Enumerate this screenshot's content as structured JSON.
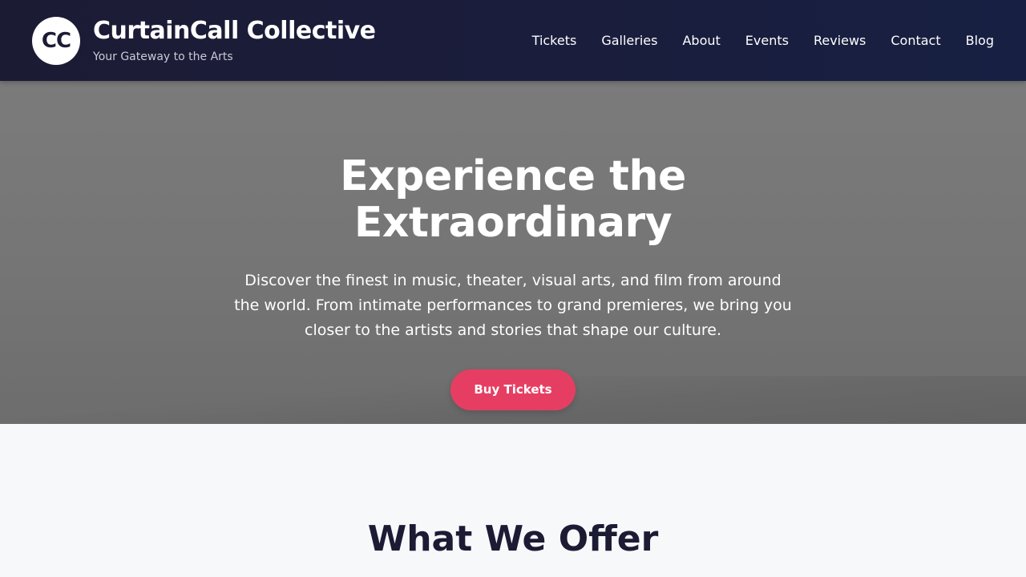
{
  "header": {
    "logo_text": "CC",
    "title": "CurtainCall Collective",
    "tagline": "Your Gateway to the Arts"
  },
  "nav": {
    "items": [
      "Tickets",
      "Galleries",
      "About",
      "Events",
      "Reviews",
      "Contact",
      "Blog"
    ]
  },
  "hero": {
    "title": "Experience the Extraordinary",
    "description": "Discover the finest in music, theater, visual arts, and film from around the world. From intimate performances to grand premieres, we bring you closer to the artists and stories that shape our culture.",
    "cta_label": "Buy Tickets"
  },
  "offer": {
    "title": "What We Offer"
  },
  "colors": {
    "header_bg": "#1c1b34",
    "accent": "#e63e62",
    "hero_bg": "#777777",
    "page_bg": "#f7f8fa"
  }
}
